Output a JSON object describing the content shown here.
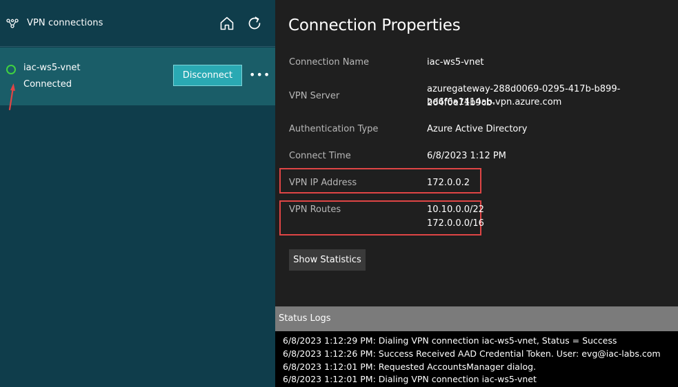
{
  "sidebar": {
    "title": "VPN connections",
    "icons": {
      "app": "vpn-network-icon",
      "home": "home-icon",
      "refresh": "refresh-icon"
    },
    "connection": {
      "name": "iac-ws5-vnet",
      "status": "Connected",
      "disconnect_label": "Disconnect",
      "more_label": "•••"
    }
  },
  "properties": {
    "title": "Connection Properties",
    "rows": [
      {
        "label": "Connection Name",
        "value": "iac-ws5-vnet"
      },
      {
        "label": "VPN Server",
        "value": "azuregateway-288d0069-0295-417b-b899-264f0e71b9cb-",
        "value2": "bd6f6a1414ab.vpn.azure.com"
      },
      {
        "label": "Authentication Type",
        "value": "Azure Active Directory"
      },
      {
        "label": "Connect Time",
        "value": "6/8/2023 1:12 PM"
      },
      {
        "label": "VPN IP Address",
        "value": "172.0.0.2"
      },
      {
        "label": "VPN Routes",
        "value": "10.10.0.0/22",
        "value2": "172.0.0.0/16"
      }
    ],
    "show_stats_label": "Show Statistics"
  },
  "logs": {
    "title": "Status Logs",
    "lines": [
      "6/8/2023 1:12:29 PM: Dialing VPN connection iac-ws5-vnet, Status = Success",
      "6/8/2023 1:12:26 PM: Success Received AAD Credential Token. User: evg@iac-labs.com",
      "6/8/2023 1:12:01 PM: Requested AccountsManager dialog.",
      "6/8/2023 1:12:01 PM: Dialing VPN connection iac-ws5-vnet"
    ]
  },
  "colors": {
    "sidebar_bg": "#0f3d4b",
    "selected_item_bg": "#1a5d68",
    "accent_button": "#2aa9b3",
    "status_connected": "#40d240",
    "highlight_annotation": "#e04545"
  }
}
